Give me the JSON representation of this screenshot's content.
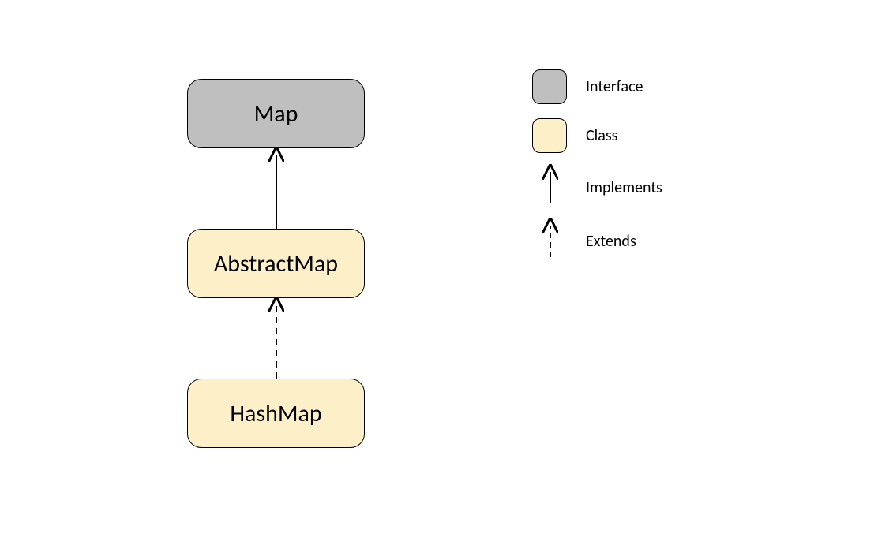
{
  "diagram": {
    "nodes": {
      "map": {
        "label": "Map",
        "type": "interface"
      },
      "abstractMap": {
        "label": "AbstractMap",
        "type": "class"
      },
      "hashMap": {
        "label": "HashMap",
        "type": "class"
      }
    },
    "edges": [
      {
        "from": "abstractMap",
        "to": "map",
        "relation": "implements"
      },
      {
        "from": "hashMap",
        "to": "abstractMap",
        "relation": "extends"
      }
    ]
  },
  "legend": {
    "interface": "Interface",
    "class": "Class",
    "implements": "Implements",
    "extends": "Extends"
  },
  "colors": {
    "interfaceFill": "#bfbfbf",
    "classFill": "#fdf0c8",
    "stroke": "#000000"
  }
}
